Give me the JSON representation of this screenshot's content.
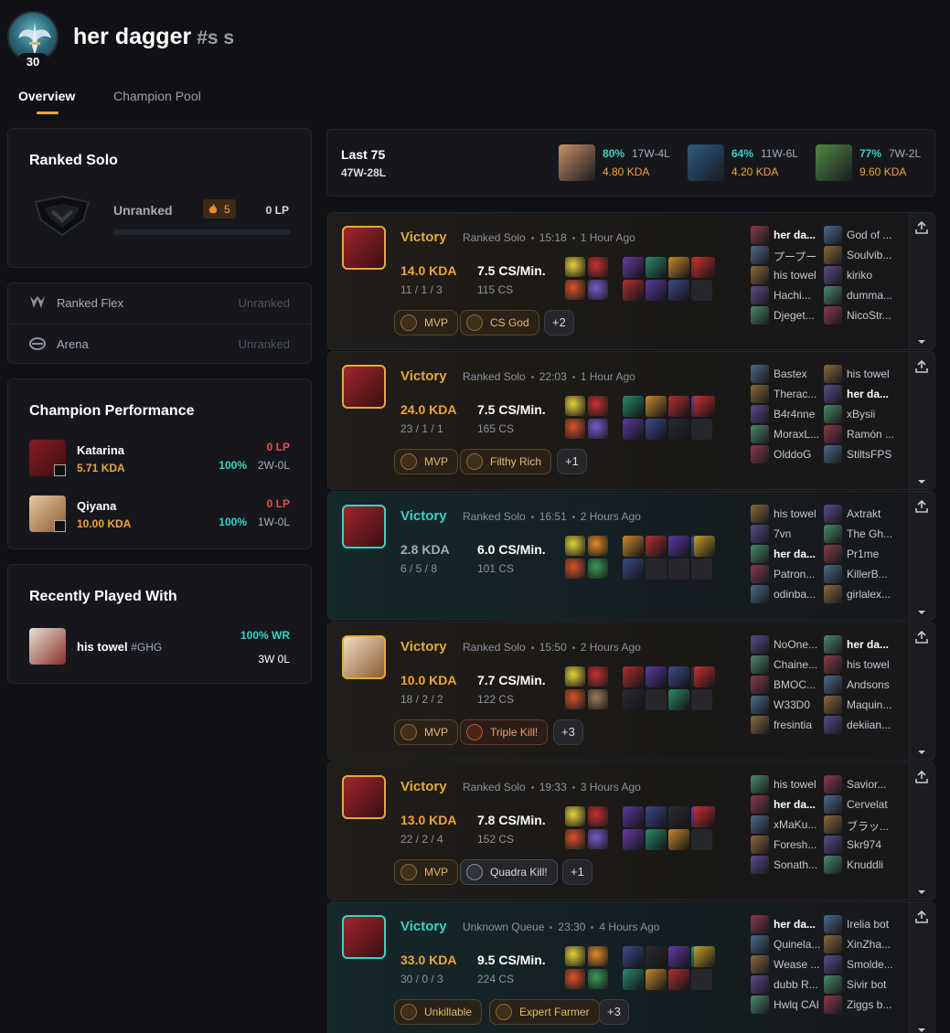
{
  "profile": {
    "name": "her dagger",
    "tag": "#s s",
    "level": "30"
  },
  "tabs": [
    {
      "label": "Overview"
    },
    {
      "label": "Champion Pool"
    }
  ],
  "ranked_solo": {
    "title": "Ranked Solo",
    "rank": "Unranked",
    "streak": "5",
    "lp": "0 LP"
  },
  "ranked_flex": {
    "title": "Ranked Flex",
    "rank": "Unranked"
  },
  "arena": {
    "title": "Arena",
    "rank": "Unranked"
  },
  "champion_performance": {
    "title": "Champion Performance",
    "items": [
      {
        "name": "Katarina",
        "kda": "5.71 KDA",
        "lp": "0 LP",
        "wr": "100%",
        "record": "2W-0L"
      },
      {
        "name": "Qiyana",
        "kda": "10.00 KDA",
        "lp": "0 LP",
        "wr": "100%",
        "record": "1W-0L"
      }
    ]
  },
  "recently_played": {
    "title": "Recently Played With",
    "items": [
      {
        "name": "his towel",
        "tag": "#GHG",
        "wr": "100% WR",
        "record": "3W 0L"
      }
    ]
  },
  "last75": {
    "title": "Last 75",
    "record": "47W-28L",
    "champs": [
      {
        "wr": "80%",
        "record": "17W-4L",
        "kda": "4.80 KDA",
        "color": "#c99064"
      },
      {
        "wr": "64%",
        "record": "11W-6L",
        "kda": "4.20 KDA",
        "color": "#2f5a82"
      },
      {
        "wr": "77%",
        "record": "7W-2L",
        "kda": "9.60 KDA",
        "color": "#4f8a42"
      }
    ]
  },
  "matches": [
    {
      "result": "Victory",
      "queue": "Ranked Solo",
      "duration": "15:18",
      "ago": "1 Hour Ago",
      "kda": "14.0 KDA",
      "kda_raw": "11 / 1 / 3",
      "cs": "7.5 CS/Min.",
      "cs_raw": "115 CS",
      "badges": [
        {
          "label": "MVP"
        },
        {
          "label": "CS God"
        }
      ],
      "more": "+2",
      "team1": [
        "her da...",
        "プープー",
        "his towel",
        "Hachi...",
        "Djeget..."
      ],
      "team2": [
        "God of ...",
        "Soulvib...",
        "kiriko",
        "dumma...",
        "NicoStr..."
      ]
    },
    {
      "result": "Victory",
      "queue": "Ranked Solo",
      "duration": "22:03",
      "ago": "1 Hour Ago",
      "kda": "24.0 KDA",
      "kda_raw": "23 / 1 / 1",
      "cs": "7.5 CS/Min.",
      "cs_raw": "165 CS",
      "badges": [
        {
          "label": "MVP"
        },
        {
          "label": "Filthy Rich"
        }
      ],
      "more": "+1",
      "team1": [
        "Bastex",
        "Therac...",
        "B4r4nne",
        "MoraxL...",
        "OlddoG"
      ],
      "team2": [
        "his towel",
        "her da...",
        "xBysii",
        "Ramón ...",
        "StiltsFPS"
      ]
    },
    {
      "result": "Victory",
      "queue": "Ranked Solo",
      "duration": "16:51",
      "ago": "2 Hours Ago",
      "kda": "2.8 KDA",
      "kda_raw": "6 / 5 / 8",
      "cs": "6.0 CS/Min.",
      "cs_raw": "101 CS",
      "badges": [],
      "more": "",
      "team1": [
        "his towel",
        "7vn",
        "her da...",
        "Patron...",
        "odinba..."
      ],
      "team2": [
        "Axtrakt",
        "The Gh...",
        "Pr1me",
        "KillerB...",
        "girlalex..."
      ]
    },
    {
      "result": "Victory",
      "queue": "Ranked Solo",
      "duration": "15:50",
      "ago": "2 Hours Ago",
      "kda": "10.0 KDA",
      "kda_raw": "18 / 2 / 2",
      "cs": "7.7 CS/Min.",
      "cs_raw": "122 CS",
      "badges": [
        {
          "label": "MVP"
        },
        {
          "label": "Triple Kill!"
        }
      ],
      "more": "+3",
      "team1": [
        "NoOne...",
        "Chaine...",
        "BMOC...",
        "W33D0",
        "fresintia"
      ],
      "team2": [
        "her da...",
        "his towel",
        "Andsons",
        "Maquin...",
        "dekiian..."
      ]
    },
    {
      "result": "Victory",
      "queue": "Ranked Solo",
      "duration": "19:33",
      "ago": "3 Hours Ago",
      "kda": "13.0 KDA",
      "kda_raw": "22 / 2 / 4",
      "cs": "7.8 CS/Min.",
      "cs_raw": "152 CS",
      "badges": [
        {
          "label": "MVP"
        },
        {
          "label": "Quadra Kill!"
        }
      ],
      "more": "+1",
      "team1": [
        "his towel",
        "her da...",
        "xMaKu...",
        "Foresh...",
        "Sonath..."
      ],
      "team2": [
        "Savior...",
        "Cervelat",
        "ブラッ...",
        "Skr974",
        "Knuddli"
      ]
    },
    {
      "result": "Victory",
      "queue": "Unknown Queue",
      "duration": "23:30",
      "ago": "4 Hours Ago",
      "kda": "33.0 KDA",
      "kda_raw": "30 / 0 / 3",
      "cs": "9.5 CS/Min.",
      "cs_raw": "224 CS",
      "badges": [
        {
          "label": "Unkillable"
        },
        {
          "label": "Expert Farmer"
        }
      ],
      "more": "+3",
      "team1": [
        "her da...",
        "Quinela...",
        "Wease ...",
        "dubb R...",
        "Hwlq CAI"
      ],
      "team2": [
        "Irelia bot",
        "XinZha...",
        "Smolde...",
        "Sivir bot",
        "Ziggs b..."
      ]
    }
  ]
}
